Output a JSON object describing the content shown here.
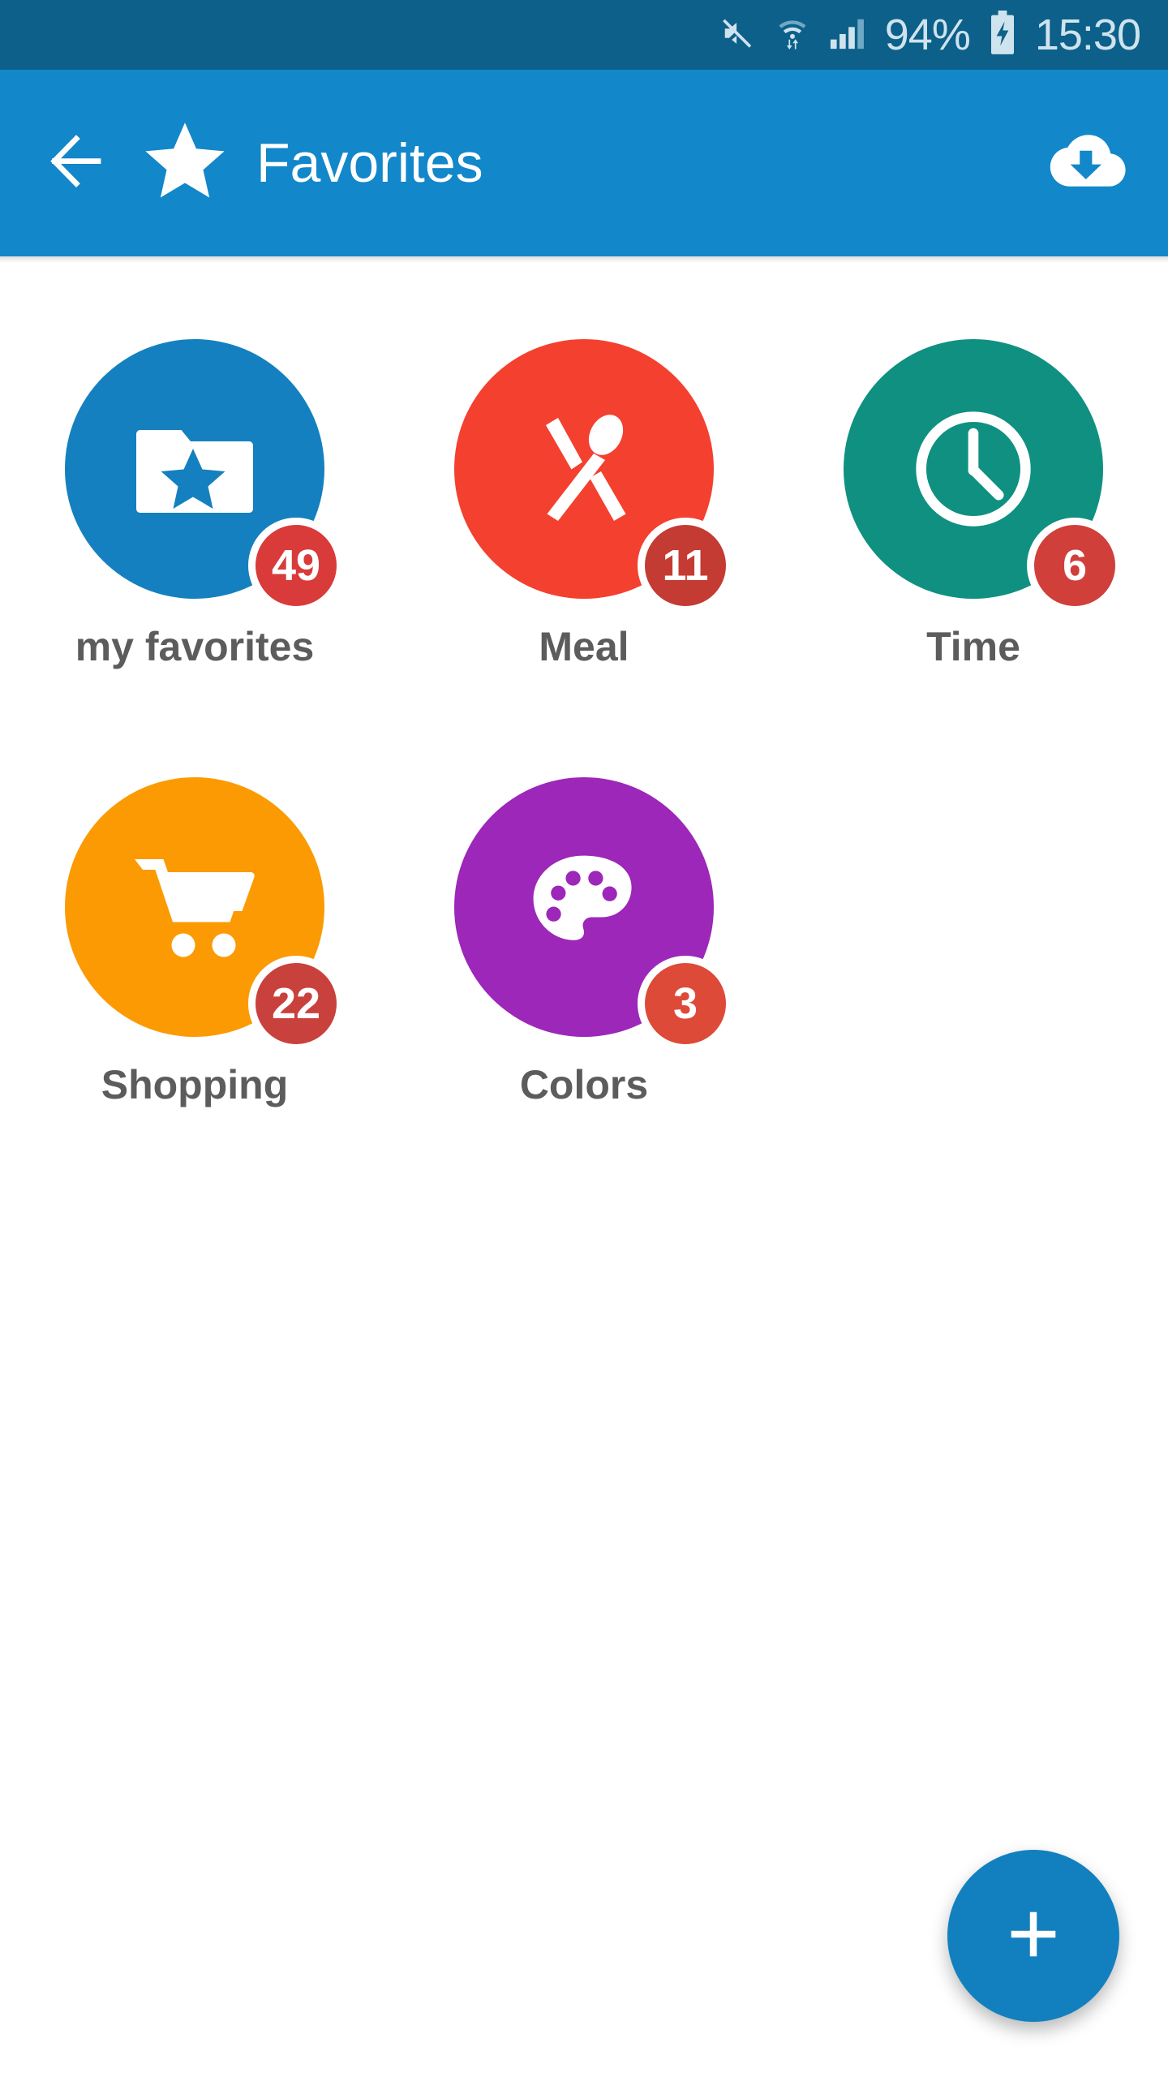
{
  "status_bar": {
    "background_color": "#0c6089",
    "battery_percent": "94%",
    "time": "15:30",
    "icons": [
      "mute-icon",
      "wifi-icon",
      "cellular-signal-icon",
      "battery-charging-icon"
    ]
  },
  "app_bar": {
    "background_color": "#1287c9",
    "title": "Favorites",
    "back_icon": "back-arrow-icon",
    "title_icon": "star-icon",
    "action_icon": "cloud-download-icon"
  },
  "categories": [
    {
      "label": "my favorites",
      "badge": "49",
      "color": "#1480bf",
      "badge_color": "#d93a3a",
      "icon": "folder-star-icon"
    },
    {
      "label": "Meal",
      "badge": "11",
      "color": "#f4402f",
      "badge_color": "#c43b33",
      "icon": "cutlery-icon"
    },
    {
      "label": "Time",
      "badge": "6",
      "color": "#0f9081",
      "badge_color": "#d03f3a",
      "icon": "clock-icon"
    },
    {
      "label": "Shopping",
      "badge": "22",
      "color": "#fb9a02",
      "badge_color": "#c9413d",
      "icon": "shopping-cart-icon"
    },
    {
      "label": "Colors",
      "badge": "3",
      "color": "#9c27b8",
      "badge_color": "#dd4a38",
      "icon": "palette-icon"
    }
  ],
  "fab": {
    "label": "+",
    "color": "#1280bf",
    "icon": "plus-icon"
  }
}
